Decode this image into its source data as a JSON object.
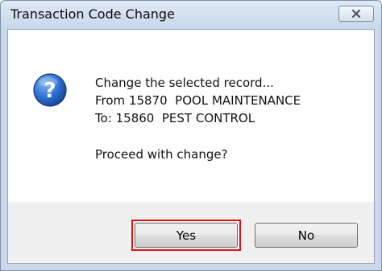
{
  "dialog": {
    "title": "Transaction Code Change",
    "icon": "question-icon",
    "message": {
      "line1": "Change the selected record...",
      "line2": "From 15870  POOL MAINTENANCE",
      "line3": "To: 15860  PEST CONTROL",
      "prompt": "Proceed with change?"
    },
    "buttons": {
      "yes_label": "Yes",
      "no_label": "No"
    },
    "highlighted_button": "yes"
  },
  "colors": {
    "highlight": "#e11414",
    "icon_blue": "#1f5fbf",
    "content_bg": "#ffffff",
    "button_bar_bg": "#f0f0f0"
  }
}
